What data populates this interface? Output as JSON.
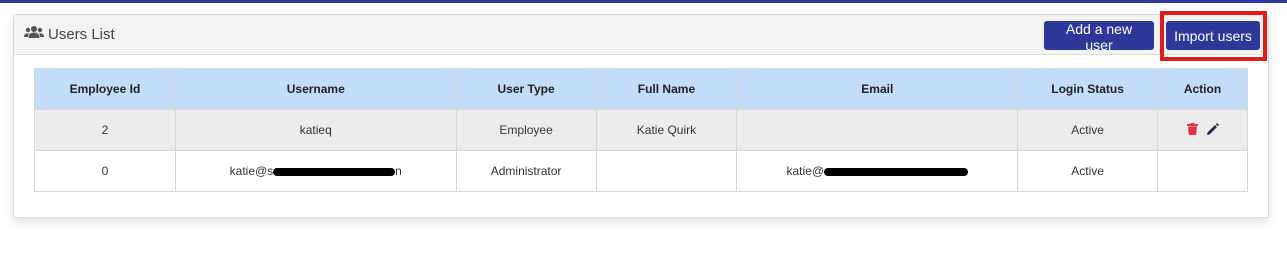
{
  "header": {
    "title": "Users List",
    "title_icon": "users-icon",
    "add_button": "Add a new user",
    "import_button": "Import users"
  },
  "table": {
    "columns": [
      "Employee Id",
      "Username",
      "User Type",
      "Full Name",
      "Email",
      "Login Status",
      "Action"
    ],
    "rows": [
      {
        "employee_id": "2",
        "username": "katieq",
        "user_type": "Employee",
        "full_name": "Katie Quirk",
        "email": "",
        "login_status": "Active",
        "actions": [
          "trash-icon",
          "pencil-icon"
        ]
      },
      {
        "employee_id": "0",
        "username_prefix": "katie@s",
        "username_suffix": "n",
        "user_type": "Administrator",
        "full_name": "",
        "email_prefix": "katie@",
        "email_suffix": "",
        "login_status": "Active",
        "actions": []
      }
    ]
  },
  "colors": {
    "accent": "#2e3899",
    "header_row": "#c2dcfa",
    "status_active": "#1f8a1f",
    "delete_icon": "#e0334a",
    "highlight": "#e31b1b"
  }
}
